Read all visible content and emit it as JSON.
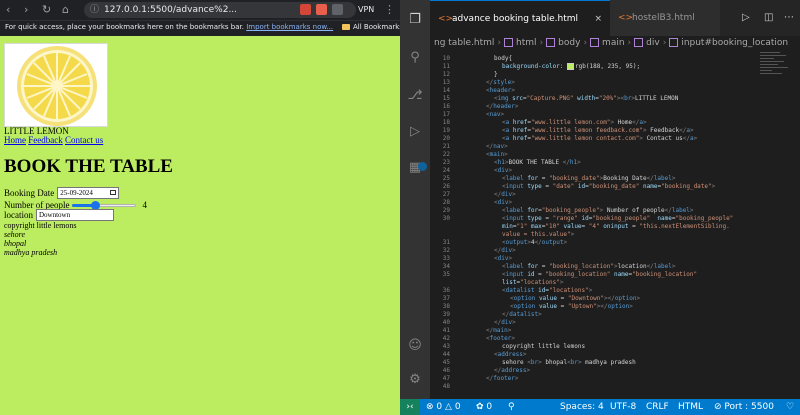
{
  "browser": {
    "url": "127.0.0.1:5500/advance%2...",
    "vpn_label": "VPN",
    "bookmarks_bar": {
      "hint": "For quick access, place your bookmarks here on the bookmarks bar.",
      "import_link": "Import bookmarks now...",
      "all_bookmarks": "All Bookmarks"
    },
    "page": {
      "brand": "LITTLE LEMON",
      "nav": [
        "Home",
        "Feedback",
        "Contact us"
      ],
      "heading": "BOOK THE TABLE",
      "date_label": "Booking Date",
      "date_value": "25-09-2024",
      "people_label": "Number of people",
      "people_value": "4",
      "people_min": 1,
      "people_max": 10,
      "location_label": "location",
      "location_value": "Downtown",
      "footer_copyright": "copyright little lemons",
      "address": [
        "sehore",
        "bhopal",
        "madhya pradesh"
      ]
    }
  },
  "editor": {
    "tabs": [
      {
        "label": "advance booking table.html",
        "active": true
      },
      {
        "label": "hostelB3.html",
        "active": false
      }
    ],
    "breadcrumbs": [
      "ng table.html",
      "html",
      "body",
      "main",
      "div",
      "input#booking_location"
    ],
    "line_numbers": [
      "10",
      "11",
      "12",
      "13",
      "14",
      "15",
      "16",
      "17",
      "18",
      "19",
      "20",
      "21",
      "22",
      "23",
      "24",
      "25",
      "26",
      "27",
      "28",
      "29",
      "30",
      "",
      "",
      "31",
      "32",
      "33",
      "34",
      "35",
      "",
      "36",
      "37",
      "38",
      "39",
      "40",
      "41",
      "42",
      "43",
      "44",
      "45",
      "46",
      "47",
      "48"
    ],
    "status": {
      "errors": "0",
      "warnings": "0",
      "ports": "0",
      "spaces": "Spaces: 4",
      "encoding": "UTF-8",
      "eol": "CRLF",
      "language": "HTML",
      "port": "Port : 5500"
    }
  }
}
